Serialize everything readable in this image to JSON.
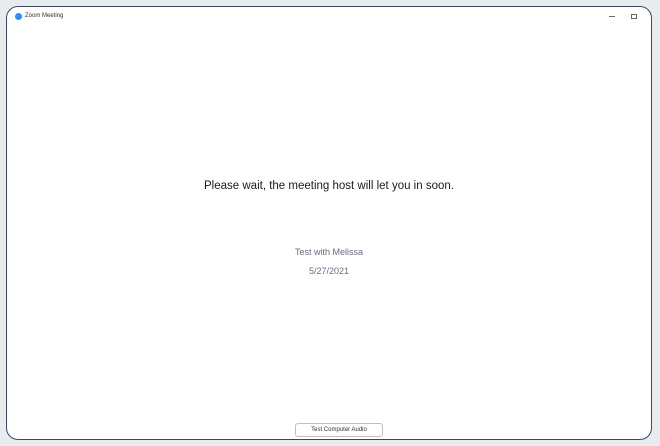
{
  "window": {
    "title": "Zoom Meeting"
  },
  "waiting_room": {
    "message": "Please wait, the meeting host will let you in soon.",
    "meeting_topic": "Test with Melissa",
    "meeting_date": "5/27/2021"
  },
  "footer": {
    "test_audio_label": "Test Computer Audio"
  },
  "colors": {
    "brand": "#2d8cff",
    "window_border": "#3a4a5c",
    "subtext": "#6b6b85"
  },
  "icons": {
    "app": "zoom-logo-icon",
    "minimize": "minimize-icon",
    "maximize": "maximize-icon"
  }
}
